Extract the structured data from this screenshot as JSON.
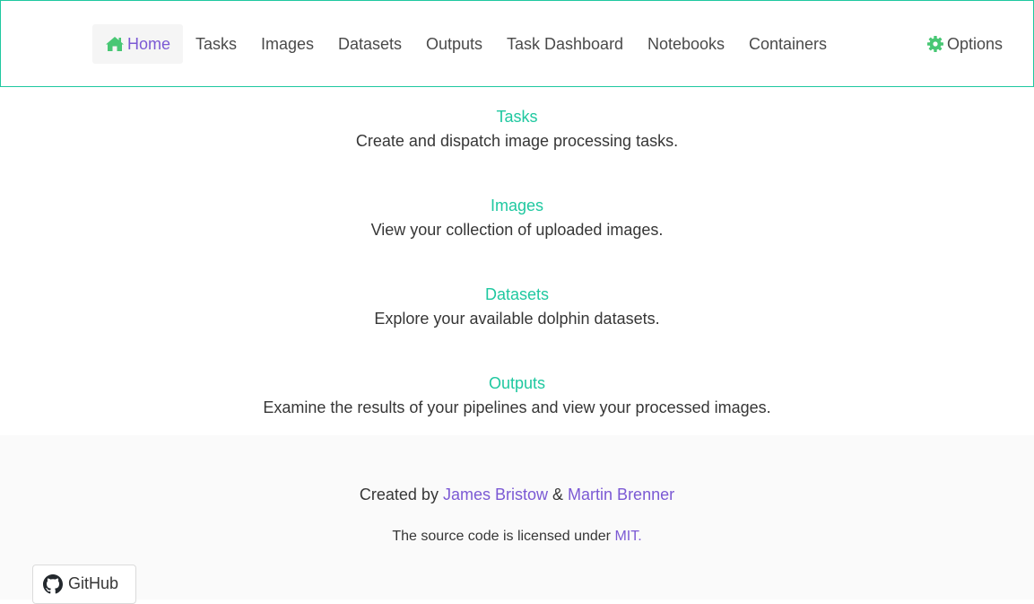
{
  "nav": {
    "home_label": "Home",
    "items": [
      {
        "label": "Tasks"
      },
      {
        "label": "Images"
      },
      {
        "label": "Datasets"
      },
      {
        "label": "Outputs"
      },
      {
        "label": "Task Dashboard"
      },
      {
        "label": "Notebooks"
      },
      {
        "label": "Containers"
      }
    ],
    "options_label": "Options"
  },
  "sections": [
    {
      "title": "Tasks",
      "description": "Create and dispatch image processing tasks."
    },
    {
      "title": "Images",
      "description": "View your collection of uploaded images."
    },
    {
      "title": "Datasets",
      "description": "Explore your available dolphin datasets."
    },
    {
      "title": "Outputs",
      "description": "Examine the results of your pipelines and view your processed images."
    }
  ],
  "footer": {
    "created_by": "Created by",
    "author1": "James Bristow",
    "ampersand": "&",
    "author2": "Martin Brenner",
    "license_text": "The source code is licensed under",
    "license_link": "MIT."
  },
  "github_button": {
    "label": "GitHub"
  },
  "colors": {
    "accent": "#1fc8a0",
    "link": "#7b59d4",
    "icon_green": "#48c774"
  },
  "icons": {
    "home": "home-icon",
    "options": "gear-icon",
    "github": "github-icon"
  }
}
